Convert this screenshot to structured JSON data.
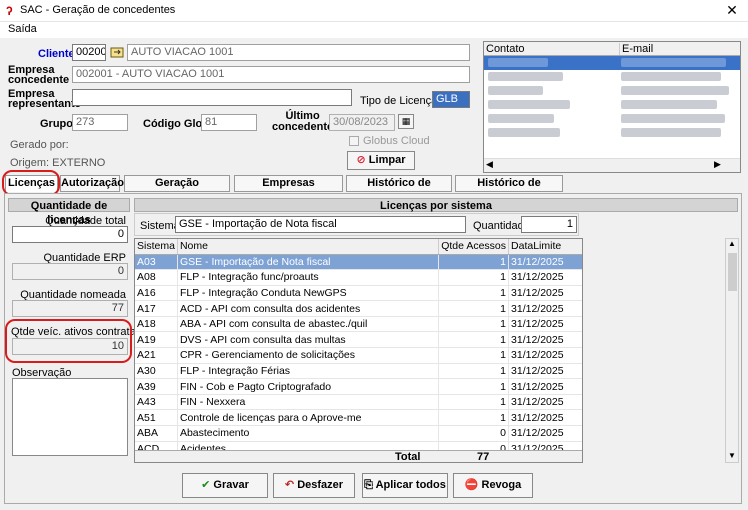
{
  "window": {
    "title": "SAC - Geração de concedentes",
    "close": "✕"
  },
  "menu": {
    "saida": "Saída"
  },
  "form": {
    "cliente_label": "Cliente",
    "cliente_code": "002001",
    "cliente_name": "AUTO VIACAO 1001",
    "empresa_concedente_label": "Empresa\nconcedente",
    "empresa_concedente_value": "002001 - AUTO VIACAO 1001",
    "empresa_representante_label": "Empresa\nrepresentante",
    "empresa_representante_value": "",
    "tipo_licenca_label": "Tipo de Licença",
    "tipo_licenca_value": "GLB",
    "grupo_label": "Grupo",
    "grupo_value": "273",
    "codigo_globus_label": "Código Globus",
    "codigo_globus_value": "81",
    "ultimo_concedente_label": "Último\nconcedente",
    "ultimo_concedente_value": "30/08/2023",
    "globus_cloud_label": "Globus Cloud",
    "gerado_por_label": "Gerado por:",
    "origem_label": "Origem: EXTERNO",
    "limpar_label": "Limpar"
  },
  "contacts": {
    "col_contato": "Contato",
    "col_email": "E-mail",
    "rows": 6
  },
  "tabs": [
    "Licenças",
    "Autorização",
    "Geração concedente",
    "Empresas autorizadas",
    "Histórico de Geração",
    "Histórico de Licenças"
  ],
  "left_panel": {
    "header": "Quantidade de licenças",
    "qtd_total_label": "Quantidade total",
    "qtd_total_value": "0",
    "qtd_erp_label": "Quantidade ERP",
    "qtd_erp_value": "0",
    "qtd_nomeada_label": "Quantidade nomeada",
    "qtd_nomeada_value": "77",
    "qtde_veic_label": "Qtde veíc. ativos contratados",
    "qtde_veic_value": "10",
    "observacao_label": "Observação"
  },
  "right_panel": {
    "header": "Licenças por sistema",
    "sistema_label": "Sistema",
    "sistema_value": "GSE - Importação de Nota fiscal",
    "quantidade_label": "Quantidade",
    "quantidade_value": "1",
    "columns": [
      "Sistema",
      "Nome",
      "Qtde Acessos",
      "DataLimite"
    ],
    "rows": [
      [
        "A03",
        "GSE - Importação de Nota fiscal",
        "1",
        "31/12/2025"
      ],
      [
        "A08",
        "FLP - Integração func/proauts",
        "1",
        "31/12/2025"
      ],
      [
        "A16",
        "FLP - Integração Conduta NewGPS",
        "1",
        "31/12/2025"
      ],
      [
        "A17",
        "ACD - API com consulta dos acidentes",
        "1",
        "31/12/2025"
      ],
      [
        "A18",
        "ABA - API com consulta de abastec./quil",
        "1",
        "31/12/2025"
      ],
      [
        "A19",
        "DVS - API com consulta das multas",
        "1",
        "31/12/2025"
      ],
      [
        "A21",
        "CPR - Gerenciamento de solicitações",
        "1",
        "31/12/2025"
      ],
      [
        "A30",
        "FLP - Integração Férias",
        "1",
        "31/12/2025"
      ],
      [
        "A39",
        "FIN - Cob e Pagto Criptografado",
        "1",
        "31/12/2025"
      ],
      [
        "A43",
        "FIN - Nexxera",
        "1",
        "31/12/2025"
      ],
      [
        "A51",
        "Controle de licenças para o Aprove-me",
        "1",
        "31/12/2025"
      ],
      [
        "ABA",
        "Abastecimento",
        "0",
        "31/12/2025"
      ],
      [
        "ACD",
        "Acidentes",
        "0",
        "31/12/2025"
      ]
    ],
    "total_label": "Total",
    "total_value": "77"
  },
  "buttons": {
    "gravar": "Gravar",
    "desfazer": "Desfazer",
    "aplicar": "Aplicar todos",
    "revoga": "Revoga"
  },
  "colors": {
    "selection": "#7ea2d4",
    "highlight_oval": "#d81c1c",
    "cliente_label": "#0000cc"
  }
}
